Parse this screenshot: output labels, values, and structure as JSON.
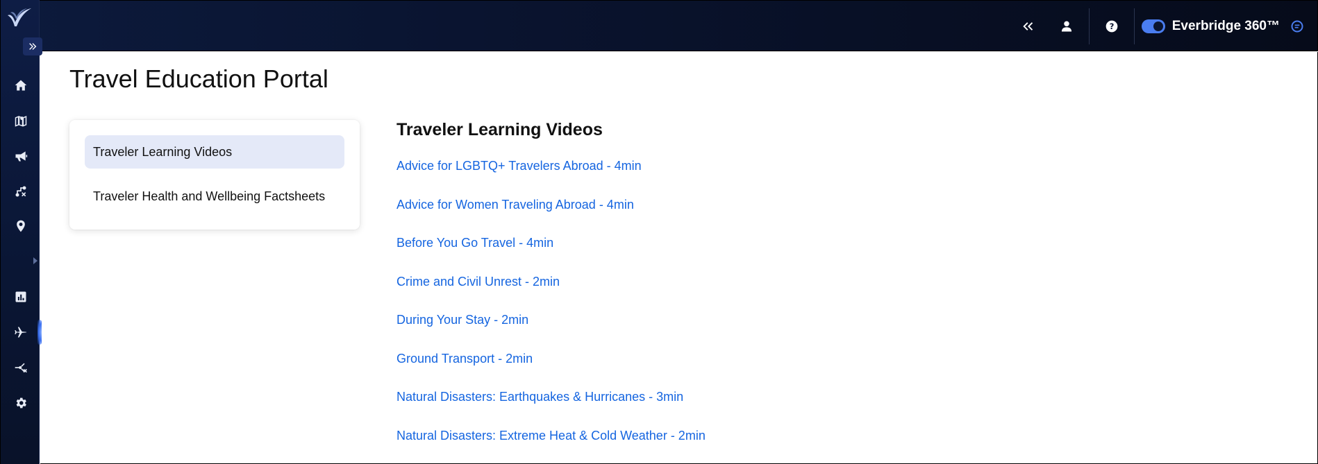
{
  "header": {
    "brand_name": "Everbridge 360™",
    "icons": [
      "collapse-left-icon",
      "user-icon",
      "help-icon",
      "chat-icon"
    ]
  },
  "sidebar": {
    "items": [
      {
        "icon": "home-icon"
      },
      {
        "icon": "map-icon"
      },
      {
        "icon": "megaphone-icon"
      },
      {
        "icon": "route-icon"
      },
      {
        "icon": "location-pin-icon"
      },
      {
        "icon": "chart-icon"
      },
      {
        "icon": "airplane-icon",
        "active": true
      },
      {
        "icon": "workflow-icon"
      },
      {
        "icon": "gear-icon"
      }
    ]
  },
  "page": {
    "title": "Travel Education Portal"
  },
  "menu": {
    "items": [
      {
        "label": "Traveler Learning Videos",
        "selected": true
      },
      {
        "label": "Traveler Health and Wellbeing Factsheets",
        "selected": false
      }
    ]
  },
  "content": {
    "section_title": "Traveler Learning Videos",
    "videos": [
      {
        "label": "Advice for LGBTQ+ Travelers Abroad - 4min"
      },
      {
        "label": "Advice for Women Traveling Abroad - 4min"
      },
      {
        "label": "Before You Go Travel - 4min"
      },
      {
        "label": "Crime and Civil Unrest - 2min"
      },
      {
        "label": "During Your Stay - 2min"
      },
      {
        "label": "Ground Transport - 2min"
      },
      {
        "label": "Natural Disasters: Earthquakes & Hurricanes - 3min"
      },
      {
        "label": "Natural Disasters: Extreme Heat & Cold Weather - 2min"
      }
    ]
  },
  "colors": {
    "link": "#1565e0",
    "selected_bg": "#e4e9f8",
    "toggle": "#4a7df0",
    "header_bg": "#0a1430"
  }
}
